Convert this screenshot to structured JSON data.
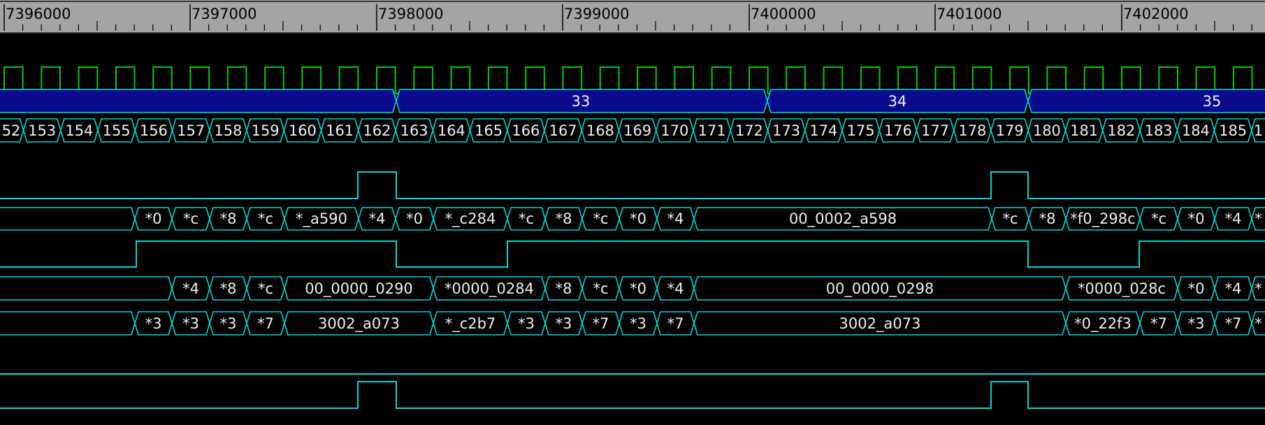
{
  "ruler": {
    "ticks": [
      "7396000",
      "7397000",
      "7398000",
      "7399000",
      "7400000",
      "7401000",
      "7402000"
    ]
  },
  "colors": {
    "background": "#000000",
    "ruler": "#a4a4a4",
    "clock": "#00d000",
    "signal": "#00d8d8",
    "bus_fill": "#0a0a8c",
    "text": "#f0f0f0"
  },
  "waveform": {
    "group_bus": {
      "labels": [
        "33",
        "34",
        "35"
      ]
    },
    "counter_bus": {
      "labels": [
        "52",
        "153",
        "154",
        "155",
        "156",
        "157",
        "158",
        "159",
        "160",
        "161",
        "162",
        "163",
        "164",
        "165",
        "166",
        "167",
        "168",
        "169",
        "170",
        "171",
        "172",
        "173",
        "174",
        "175",
        "176",
        "177",
        "178",
        "179",
        "180",
        "181",
        "182",
        "183",
        "184",
        "185",
        "1"
      ]
    },
    "bus_a": {
      "labels": [
        "*0",
        "*c",
        "*8",
        "*c",
        "*_a590",
        "*4",
        "*0",
        "*_c284",
        "*c",
        "*8",
        "*c",
        "*0",
        "*4",
        "00_0002_a598",
        "*c",
        "*8",
        "*f0_298c",
        "*c",
        "*0",
        "*4",
        "*"
      ]
    },
    "bus_b": {
      "labels": [
        "*4",
        "*8",
        "*c",
        "00_0000_0290",
        "*0000_0284",
        "*8",
        "*c",
        "*0",
        "*4",
        "00_0000_0298",
        "*0000_028c",
        "*0",
        "*4",
        "*"
      ]
    },
    "bus_c": {
      "labels": [
        "*3",
        "*3",
        "*3",
        "*7",
        "3002_a073",
        "*_c2b7",
        "*3",
        "*3",
        "*7",
        "*3",
        "*7",
        "3002_a073",
        "*0_22f3",
        "*7",
        "*3",
        "*7",
        "*"
      ]
    }
  }
}
